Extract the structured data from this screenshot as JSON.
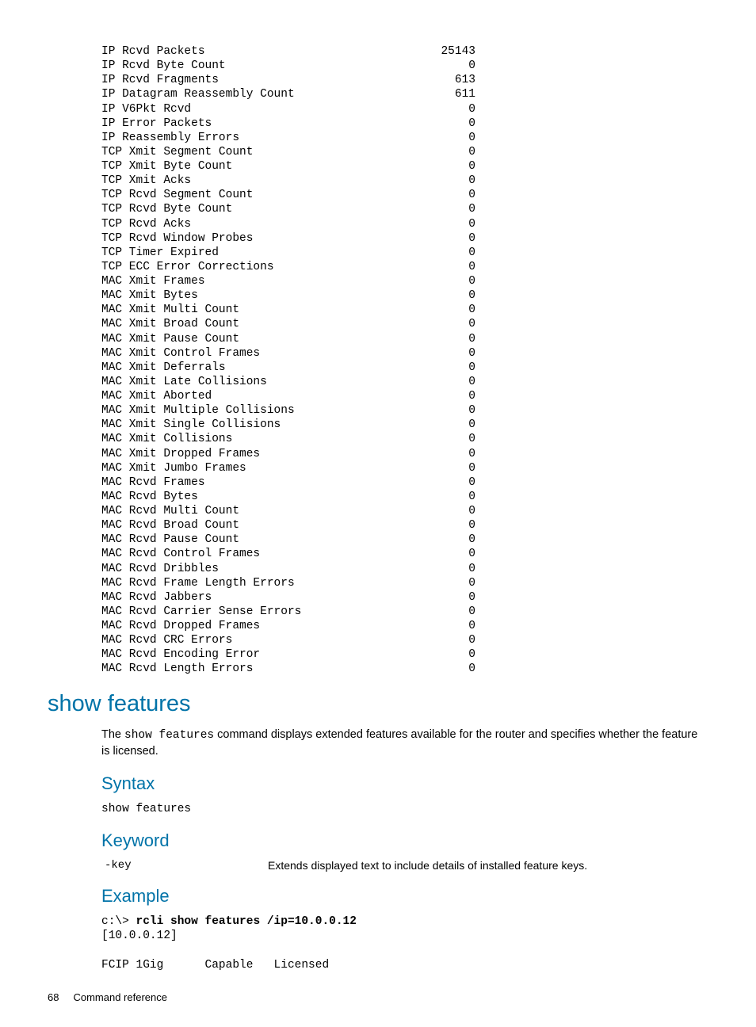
{
  "stats": [
    {
      "label": "IP Rcvd Packets",
      "value": "25143"
    },
    {
      "label": "IP Rcvd Byte Count",
      "value": "0"
    },
    {
      "label": "IP Rcvd Fragments",
      "value": "613"
    },
    {
      "label": "IP Datagram Reassembly Count",
      "value": "611"
    },
    {
      "label": "IP V6Pkt Rcvd",
      "value": "0"
    },
    {
      "label": "IP Error Packets",
      "value": "0"
    },
    {
      "label": "IP Reassembly Errors",
      "value": "0"
    },
    {
      "label": "TCP Xmit Segment Count",
      "value": "0"
    },
    {
      "label": "TCP Xmit Byte Count",
      "value": "0"
    },
    {
      "label": "TCP Xmit Acks",
      "value": "0"
    },
    {
      "label": "TCP Rcvd Segment Count",
      "value": "0"
    },
    {
      "label": "TCP Rcvd Byte Count",
      "value": "0"
    },
    {
      "label": "TCP Rcvd Acks",
      "value": "0"
    },
    {
      "label": "TCP Rcvd Window Probes",
      "value": "0"
    },
    {
      "label": "TCP Timer Expired",
      "value": "0"
    },
    {
      "label": "TCP ECC Error Corrections",
      "value": "0"
    },
    {
      "label": "MAC Xmit Frames",
      "value": "0"
    },
    {
      "label": "MAC Xmit Bytes",
      "value": "0"
    },
    {
      "label": "MAC Xmit Multi Count",
      "value": "0"
    },
    {
      "label": "MAC Xmit Broad Count",
      "value": "0"
    },
    {
      "label": "MAC Xmit Pause Count",
      "value": "0"
    },
    {
      "label": "MAC Xmit Control Frames",
      "value": "0"
    },
    {
      "label": "MAC Xmit Deferrals",
      "value": "0"
    },
    {
      "label": "MAC Xmit Late Collisions",
      "value": "0"
    },
    {
      "label": "MAC Xmit Aborted",
      "value": "0"
    },
    {
      "label": "MAC Xmit Multiple Collisions",
      "value": "0"
    },
    {
      "label": "MAC Xmit Single Collisions",
      "value": "0"
    },
    {
      "label": "MAC Xmit Collisions",
      "value": "0"
    },
    {
      "label": "MAC Xmit Dropped Frames",
      "value": "0"
    },
    {
      "label": "MAC Xmit Jumbo Frames",
      "value": "0"
    },
    {
      "label": "MAC Rcvd Frames",
      "value": "0"
    },
    {
      "label": "MAC Rcvd Bytes",
      "value": "0"
    },
    {
      "label": "MAC Rcvd Multi Count",
      "value": "0"
    },
    {
      "label": "MAC Rcvd Broad Count",
      "value": "0"
    },
    {
      "label": "MAC Rcvd Pause Count",
      "value": "0"
    },
    {
      "label": "MAC Rcvd Control Frames",
      "value": "0"
    },
    {
      "label": "MAC Rcvd Dribbles",
      "value": "0"
    },
    {
      "label": "MAC Rcvd Frame Length Errors",
      "value": "0"
    },
    {
      "label": "MAC Rcvd Jabbers",
      "value": "0"
    },
    {
      "label": "MAC Rcvd Carrier Sense Errors",
      "value": "0"
    },
    {
      "label": "MAC Rcvd Dropped Frames",
      "value": "0"
    },
    {
      "label": "MAC Rcvd CRC Errors",
      "value": "0"
    },
    {
      "label": "MAC Rcvd Encoding Error",
      "value": "0"
    },
    {
      "label": "MAC Rcvd Length Errors",
      "value": "0"
    }
  ],
  "section": {
    "title": "show features",
    "intro_prefix": "The ",
    "intro_command": "show features",
    "intro_suffix": " command displays extended features available for the router and specifies whether the feature is licensed."
  },
  "syntax": {
    "title": "Syntax",
    "text": "show features"
  },
  "keyword": {
    "title": "Keyword",
    "name": "-key",
    "desc": "Extends displayed text to include details of installed feature keys."
  },
  "example": {
    "title": "Example",
    "prompt": "c:\\> ",
    "command": "rcli show features /ip=10.0.0.12",
    "line2": "[10.0.0.12]",
    "line3": "",
    "line4": "FCIP 1Gig      Capable   Licensed"
  },
  "footer": {
    "page": "68",
    "title": "Command reference"
  }
}
